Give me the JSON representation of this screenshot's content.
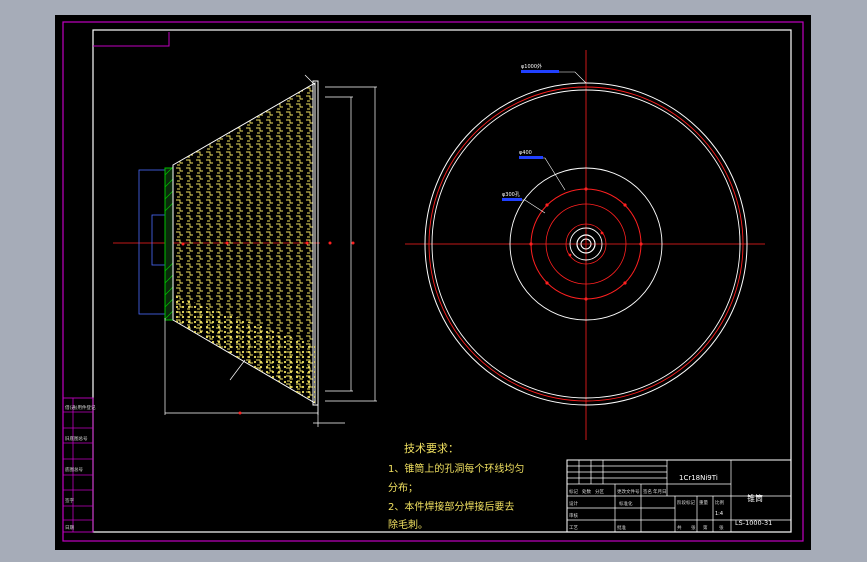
{
  "drawing": {
    "background": "#000000",
    "viewport_frame_color": "#a6acb8",
    "colors": {
      "frame": "#c000c0",
      "border": "#ffffff",
      "centerline": "#ff2020",
      "pattern": "#f0e060",
      "weld": "#00c000",
      "dimension": "#ffffff"
    },
    "tech_requirements": {
      "heading": "技术要求：",
      "lines": [
        "1、锥筒上的孔洞每个环线均匀",
        "分布；",
        "2、本件焊接部分焊接后要去",
        "除毛刺。"
      ]
    },
    "title_block": {
      "material": "1Cr18Ni9Ti",
      "part_name": "锥筒",
      "drawing_number": "LS-1000-31",
      "scale": "1:4",
      "header_row": [
        "标记",
        "处数",
        "分区",
        "更改文件号",
        "签名",
        "年月日"
      ],
      "labels": [
        "设计",
        "审核",
        "工艺",
        "批准"
      ],
      "stage_labels": [
        "阶段标记",
        "重量",
        "比例"
      ],
      "sheet_labels": [
        "共",
        "张",
        "第",
        "张"
      ],
      "standardization": "标准化"
    },
    "side_table": {
      "rows": [
        "借(通)用件登记",
        "旧底图总号",
        "底图总号",
        "签字",
        "日期"
      ]
    },
    "callouts": {
      "top_circle": "φ1000外",
      "mid_circle": "φ400",
      "inner_circle": "φ300孔"
    }
  }
}
